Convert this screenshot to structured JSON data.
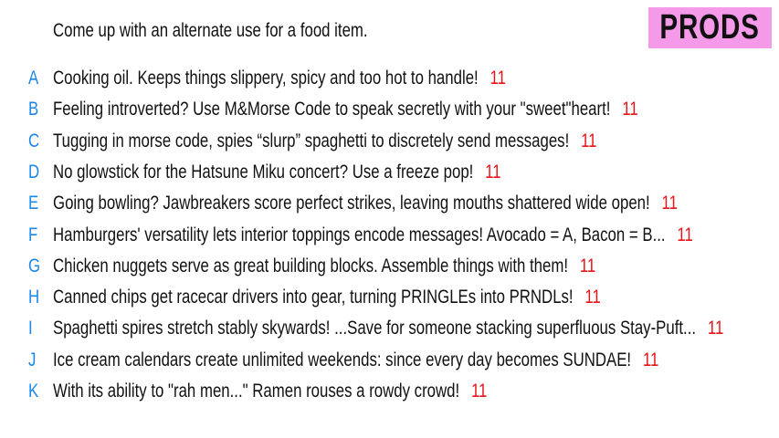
{
  "prompt": "Come up with an alternate use for a food item.",
  "badge": {
    "label": "PRODS",
    "color": "#f49ae8"
  },
  "colors": {
    "letter": "#1a86e8",
    "score": "#e8141a"
  },
  "answers": [
    {
      "letter": "A",
      "text": "Cooking oil. Keeps things slippery, spicy and too hot to handle!",
      "score": "11"
    },
    {
      "letter": "B",
      "text": "Feeling introverted? Use M&Morse Code to speak secretly with your \"sweet\"heart!",
      "score": "11"
    },
    {
      "letter": "C",
      "text": "Tugging in morse code, spies “slurp” spaghetti to discretely send messages!",
      "score": "11"
    },
    {
      "letter": "D",
      "text": "No glowstick for the Hatsune Miku concert? Use a freeze pop!",
      "score": "11"
    },
    {
      "letter": "E",
      "text": "Going bowling? Jawbreakers score perfect strikes, leaving mouths shattered wide open!",
      "score": "11"
    },
    {
      "letter": "F",
      "text": "Hamburgers' versatility lets interior toppings encode messages! Avocado = A, Bacon = B...",
      "score": "11"
    },
    {
      "letter": "G",
      "text": "Chicken nuggets serve as great building blocks. Assemble things with them!",
      "score": "11"
    },
    {
      "letter": "H",
      "text": "Canned chips get racecar drivers into gear, turning PRINGLEs into PRNDLs!",
      "score": "11"
    },
    {
      "letter": "I",
      "text": "Spaghetti spires stretch stably skywards! ...Save for someone stacking superfluous Stay-Puft...",
      "score": "11"
    },
    {
      "letter": "J",
      "text": "Ice cream calendars create unlimited weekends: since every day becomes SUNDAE!",
      "score": "11"
    },
    {
      "letter": "K",
      "text": "With its ability to \"rah men...\" Ramen rouses a rowdy crowd!",
      "score": "11"
    }
  ]
}
